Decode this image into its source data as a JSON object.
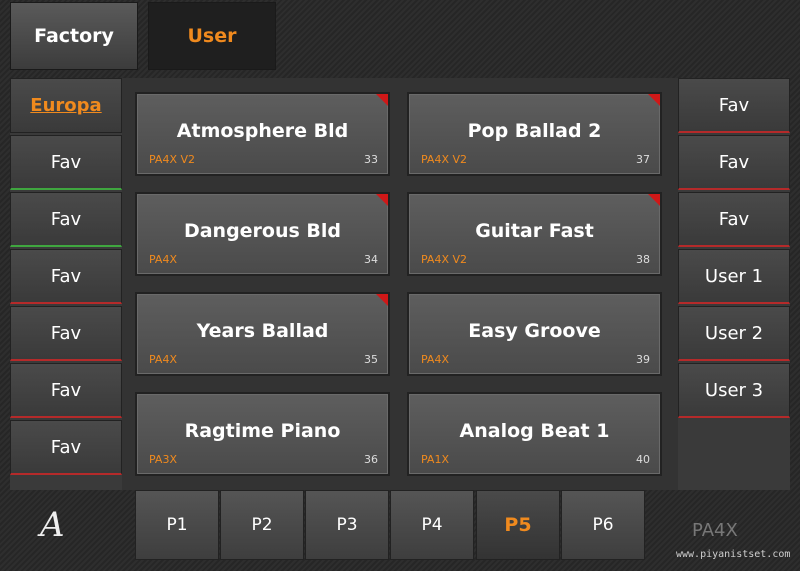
{
  "tabs": {
    "factory": "Factory",
    "user": "User"
  },
  "left_banks": [
    "Europa",
    "Fav",
    "Fav",
    "Fav",
    "Fav",
    "Fav",
    "Fav"
  ],
  "right_banks": [
    "Fav",
    "Fav",
    "Fav",
    "User 1",
    "User 2",
    "User 3"
  ],
  "styles": [
    {
      "name": "Atmosphere Bld",
      "model": "PA4X V2",
      "number": "33"
    },
    {
      "name": "Pop Ballad 2",
      "model": "PA4X V2",
      "number": "37"
    },
    {
      "name": "Dangerous Bld",
      "model": "PA4X",
      "number": "34"
    },
    {
      "name": "Guitar Fast",
      "model": "PA4X V2",
      "number": "38"
    },
    {
      "name": "Years Ballad",
      "model": "PA4X",
      "number": "35"
    },
    {
      "name": "Easy Groove",
      "model": "PA4X",
      "number": "39"
    },
    {
      "name": "Ragtime Piano",
      "model": "PA3X",
      "number": "36"
    },
    {
      "name": "Analog Beat 1",
      "model": "PA1X",
      "number": "40"
    }
  ],
  "pages": [
    "P1",
    "P2",
    "P3",
    "P4",
    "P5",
    "P6"
  ],
  "active_page": "P5",
  "logo": "A",
  "model_label": "PA4X",
  "watermark": "www.piyanistset.com",
  "colors": {
    "accent": "#f08a1e",
    "marker": "#d01818"
  }
}
